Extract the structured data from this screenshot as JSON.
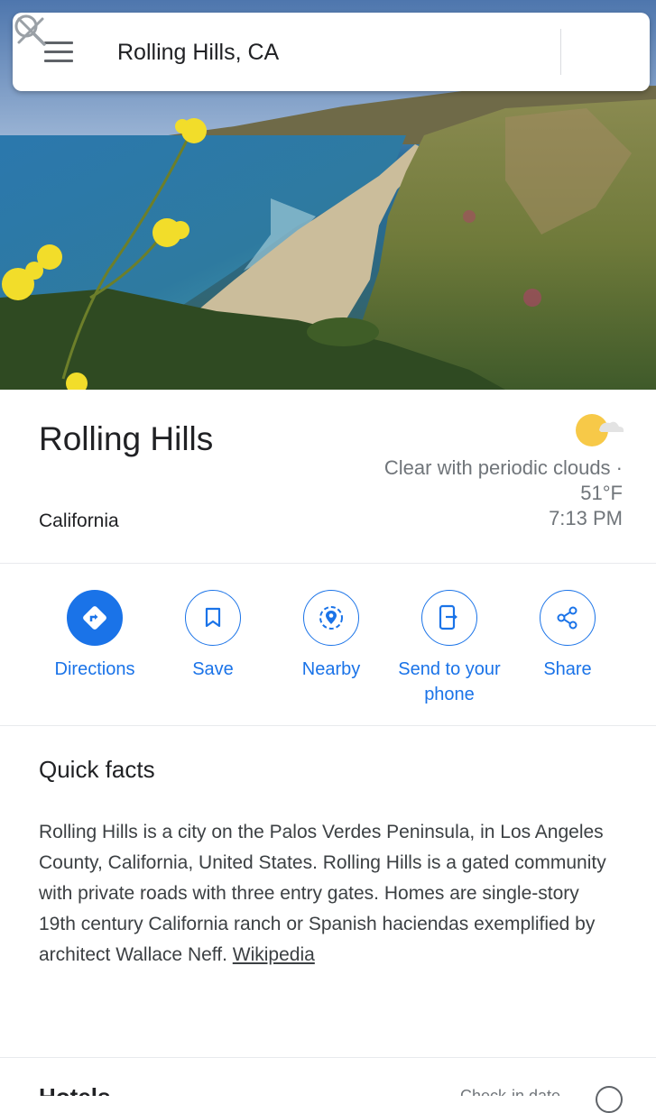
{
  "search": {
    "value": "Rolling Hills, CA",
    "menu_icon": "hamburger-menu-icon",
    "search_icon": "magnifier-icon",
    "close_icon": "close-x-icon"
  },
  "place": {
    "name": "Rolling Hills",
    "region": "California"
  },
  "weather": {
    "icon": "partly-cloudy-icon",
    "condition": "Clear with periodic clouds ·",
    "temperature": "51°F",
    "time": "7:13 PM"
  },
  "actions": [
    {
      "label": "Directions",
      "icon": "directions-icon"
    },
    {
      "label": "Save",
      "icon": "bookmark-icon"
    },
    {
      "label": "Nearby",
      "icon": "nearby-icon"
    },
    {
      "label": "Send to your phone",
      "icon": "send-to-phone-icon"
    },
    {
      "label": "Share",
      "icon": "share-icon"
    }
  ],
  "quick_facts": {
    "heading": "Quick facts",
    "body": "Rolling Hills is a city on the Palos Verdes Peninsula, in Los Angeles County, California, United States. Rolling Hills is a gated community with private roads with three entry gates. Homes are single-story 19th century California ranch or Spanish haciendas exemplified by architect Wallace Neff.",
    "source_link": "Wikipedia"
  },
  "next_section": {
    "heading": "Hotels",
    "right_text": "Check-in date"
  },
  "colors": {
    "accent": "#1a73e8",
    "text_primary": "#202124",
    "text_secondary": "#70757a"
  }
}
